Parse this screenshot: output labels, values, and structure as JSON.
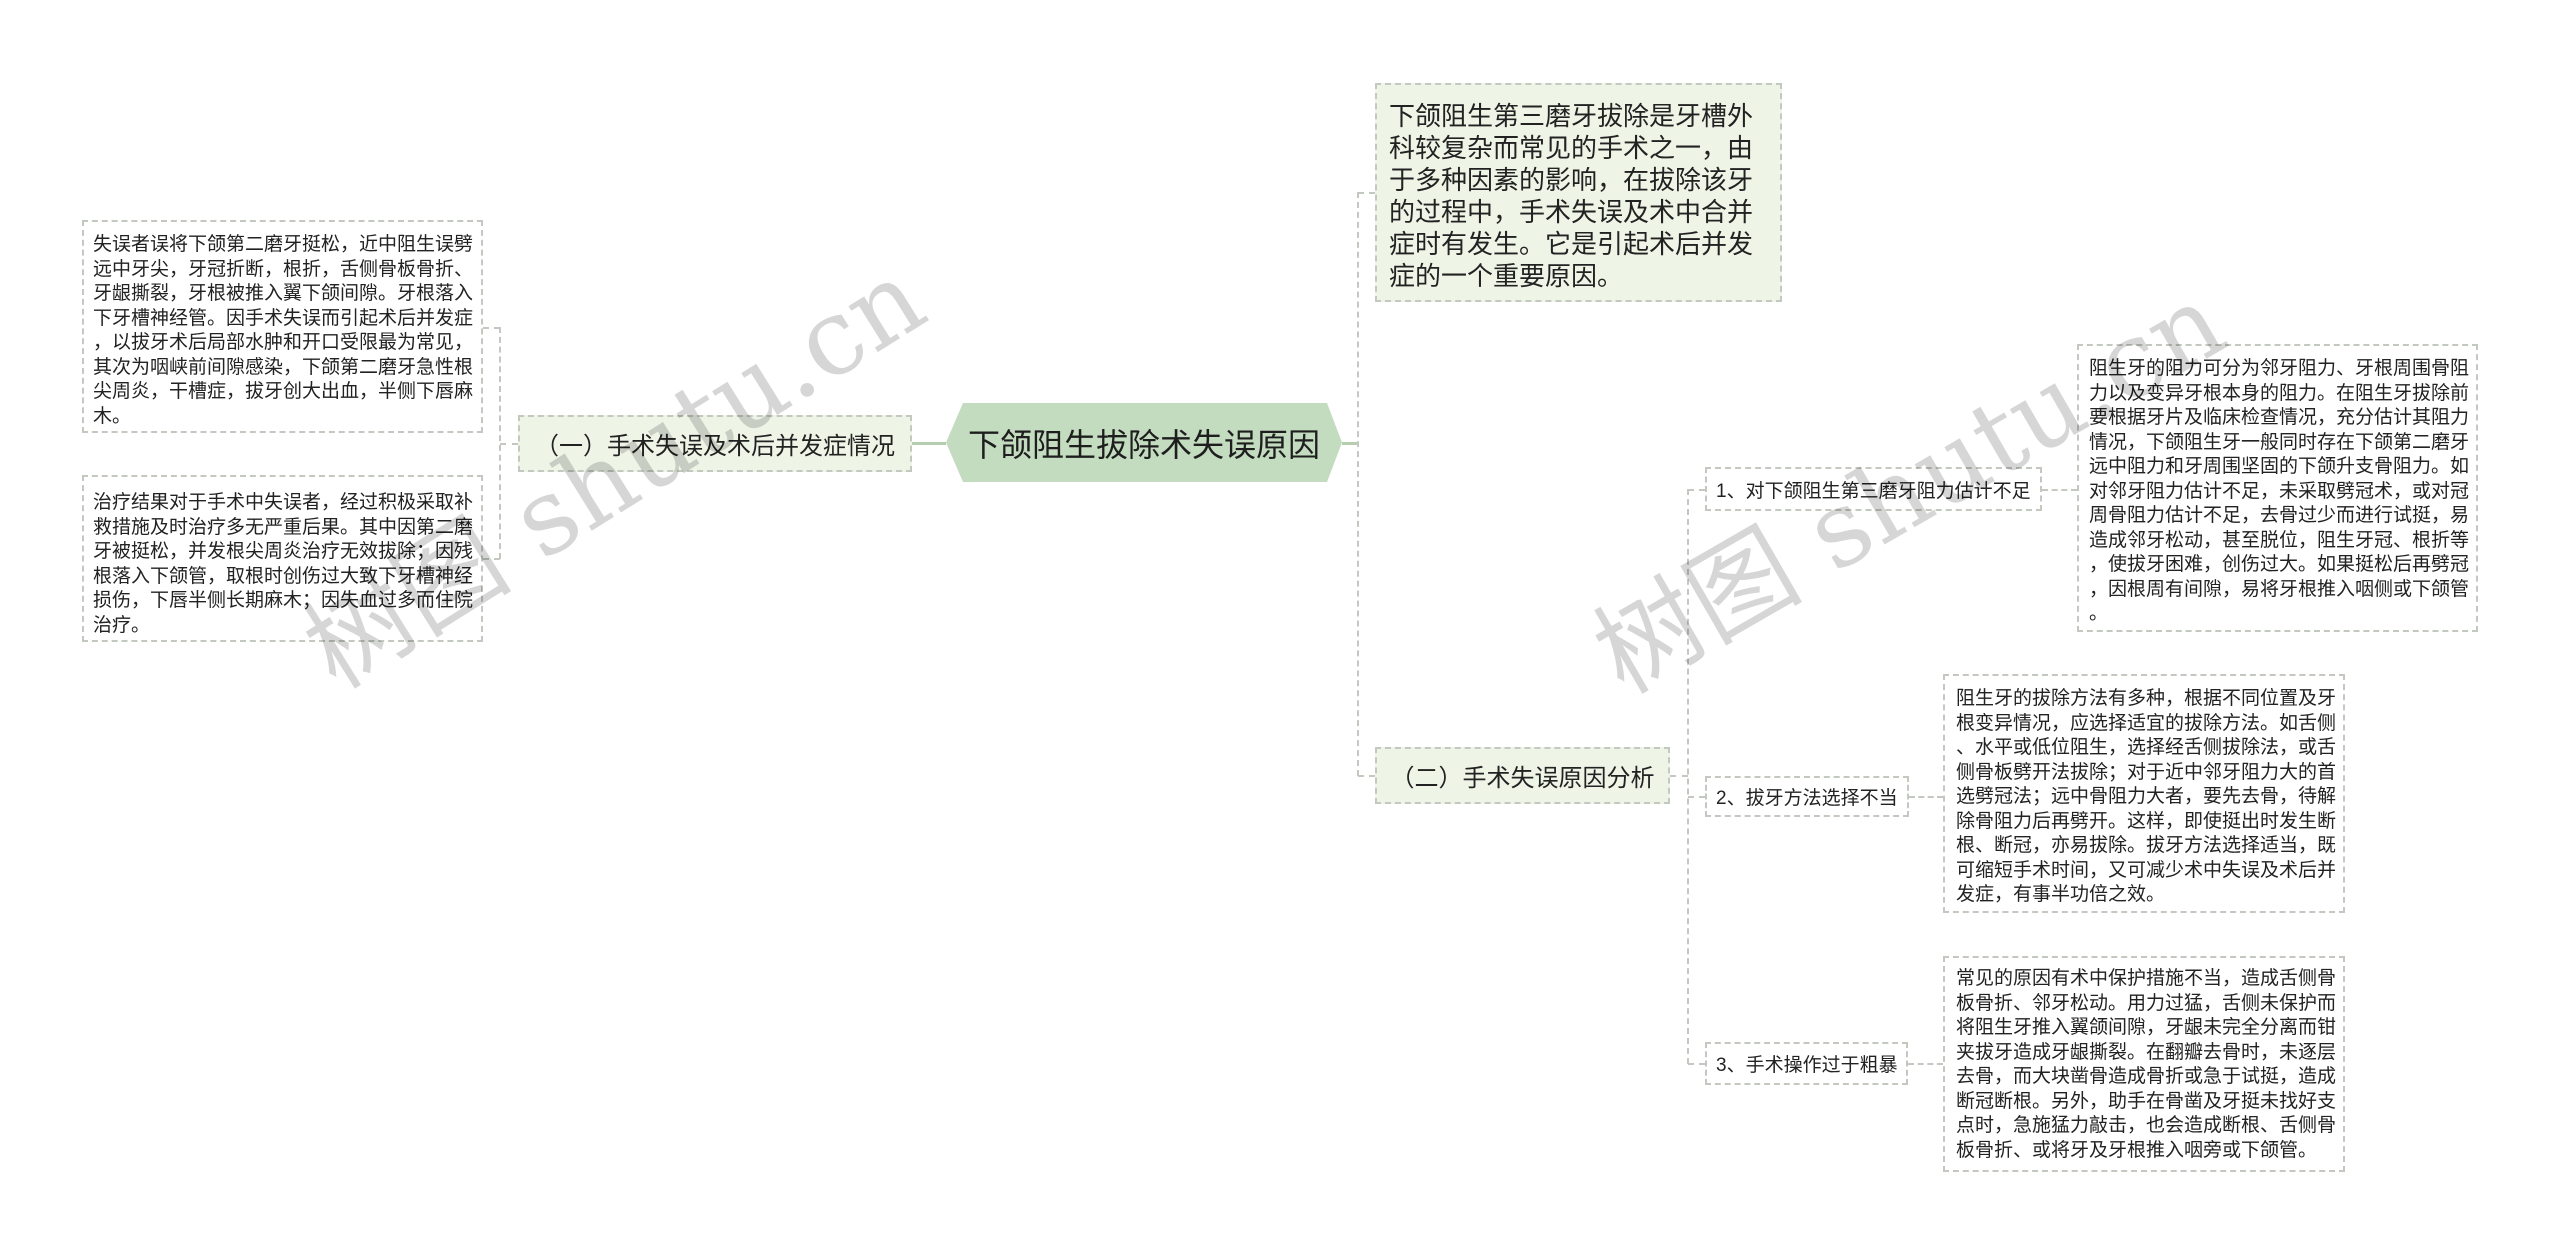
{
  "theme": {
    "root_fill": "#c3dbbf",
    "branch_fill": "#eef5e7",
    "connector": "#b6cdb0",
    "dash": "#c3c9c0",
    "text": "#222222"
  },
  "mindmap": {
    "root": {
      "label": "下颌阻生拔除术失误原因"
    },
    "left_branch": {
      "label": "（一）手术失误及术后并发症情况",
      "notes": [
        "失误者误将下颌第二磨牙挺松，近中阻生误劈远中牙尖，牙冠折断，根折，舌侧骨板骨折、牙龈撕裂，牙根被推入翼下颌间隙。牙根落入下牙槽神经管。因手术失误而引起术后并发症，以拔牙术后局部水肿和开口受限最为常见，其次为咽峡前间隙感染，下颌第二磨牙急性根尖周炎，干槽症，拔牙创大出血，半侧下唇麻木。",
        "治疗结果对于手术中失误者，经过积极采取补救措施及时治疗多无严重后果。其中因第二磨牙被挺松，并发根尖周炎治疗无效拔除；因残根落入下颌管，取根时创伤过大致下牙槽神经损伤，下唇半侧长期麻木；因失血过多而住院治疗。"
      ]
    },
    "right_intro": {
      "text": "下颌阻生第三磨牙拔除是牙槽外科较复杂而常见的手术之一，由于多种因素的影响，在拔除该牙的过程中，手术失误及术中合并症时有发生。它是引起术后并发症的一个重要原因。"
    },
    "right_branch": {
      "label": "（二）手术失误原因分析",
      "items": [
        {
          "label": "1、对下颌阻生第三磨牙阻力估计不足",
          "note": "阻生牙的阻力可分为邻牙阻力、牙根周围骨阻力以及变异牙根本身的阻力。在阻生牙拔除前要根据牙片及临床检查情况，充分估计其阻力情况，下颌阻生牙一般同时存在下颌第二磨牙远中阻力和牙周围坚固的下颌升支骨阻力。如对邻牙阻力估计不足，未采取劈冠术，或对冠周骨阻力估计不足，去骨过少而进行试挺，易造成邻牙松动，甚至脱位，阻生牙冠、根折等，使拔牙困难，创伤过大。如果挺松后再劈冠，因根周有间隙，易将牙根推入咽侧或下颌管。"
        },
        {
          "label": "2、拔牙方法选择不当",
          "note": "阻生牙的拔除方法有多种，根据不同位置及牙根变异情况，应选择适宜的拔除方法。如舌侧、水平或低位阻生，选择经舌侧拔除法，或舌侧骨板劈开法拔除；对于近中邻牙阻力大的首选劈冠法；远中骨阻力大者，要先去骨，待解除骨阻力后再劈开。这样，即使挺出时发生断根、断冠，亦易拔除。拔牙方法选择适当，既可缩短手术时间，又可减少术中失误及术后并发症，有事半功倍之效。"
        },
        {
          "label": "3、手术操作过于粗暴",
          "note": "常见的原因有术中保护措施不当，造成舌侧骨板骨折、邻牙松动。用力过猛，舌侧未保护而将阻生牙推入翼颌间隙，牙龈未完全分离而钳夹拔牙造成牙龈撕裂。在翻瓣去骨时，未逐层去骨，而大块凿骨造成骨折或急于试挺，造成断冠断根。另外，助手在骨凿及牙挺未找好支点时，急施猛力敲击，也会造成断根、舌侧骨板骨折、或将牙及牙根推入咽旁或下颌管。"
        }
      ]
    }
  },
  "watermark": {
    "text": "树图 shutu.cn"
  }
}
